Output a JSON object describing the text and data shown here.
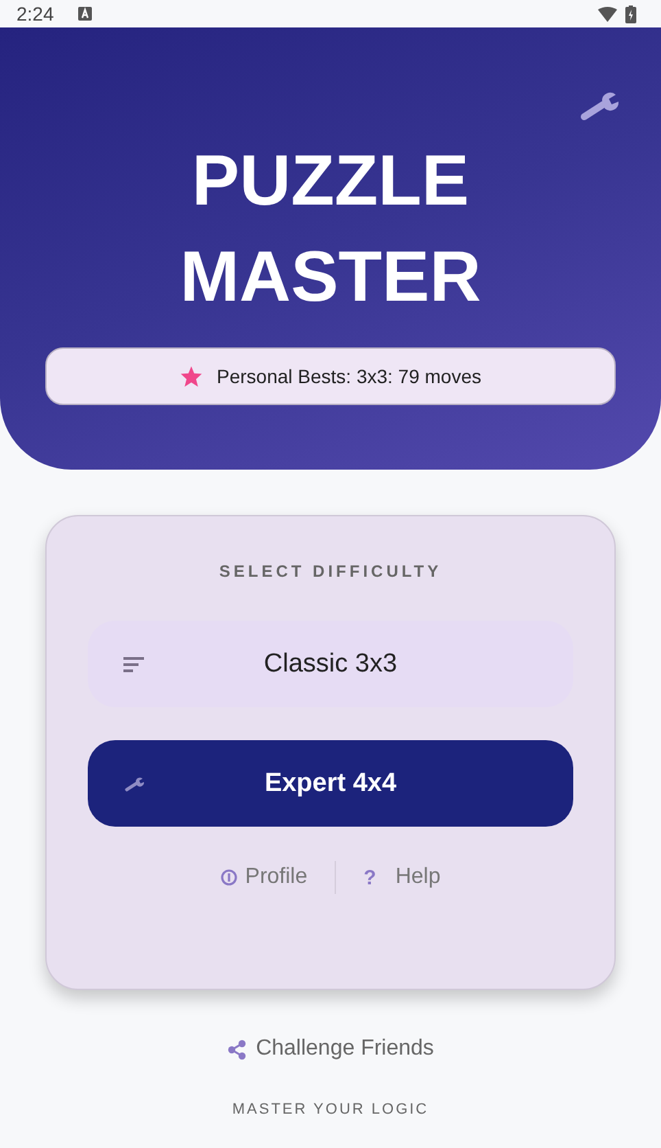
{
  "status_bar": {
    "time": "2:24"
  },
  "header": {
    "title_lines": [
      "PUZZLE",
      "MASTER"
    ],
    "personal_bests": "Personal Bests: 3x3: 79 moves"
  },
  "difficulty": {
    "heading": "SELECT DIFFICULTY",
    "modes": [
      {
        "label": "Classic 3x3",
        "kind": "sort",
        "selected": false
      },
      {
        "label": "Expert 4x4",
        "kind": "wrench",
        "selected": true
      }
    ]
  },
  "links": [
    {
      "label": "Profile",
      "kind": "info"
    },
    {
      "label": "Help",
      "kind": "help",
      "glyph": "?"
    }
  ],
  "challenge": "Challenge Friends",
  "footer": "MASTER YOUR LOGIC"
}
